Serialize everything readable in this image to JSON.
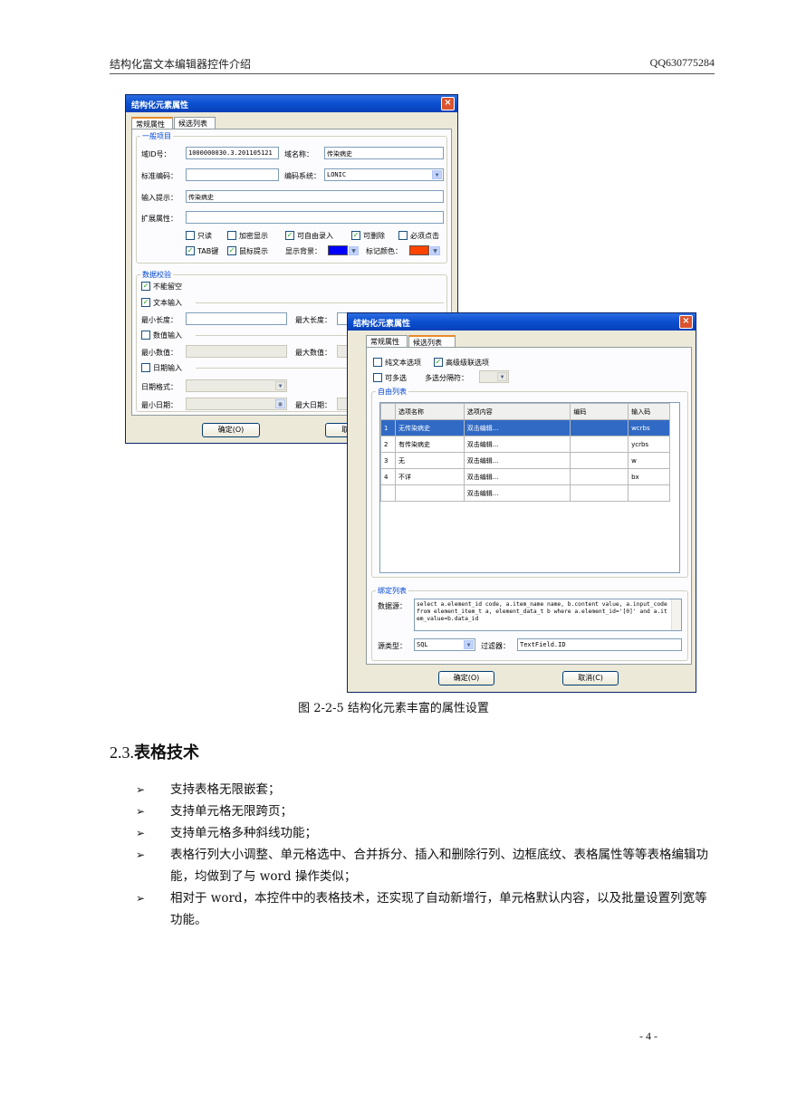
{
  "header": {
    "left": "结构化富文本编辑器控件介绍",
    "right": "QQ630775284"
  },
  "dialog1": {
    "title": "结构化元素属性",
    "tabs": [
      "常规属性",
      "候选列表"
    ],
    "group_general": "一般项目",
    "labels": {
      "field_id": "域ID号：",
      "field_name": "域名称：",
      "std_code": "标准编码：",
      "code_system": "编码系统：",
      "input_hint": "输入提示：",
      "ext_attr": "扩展属性：",
      "show_bg": "显示背景：",
      "mark_color": "标记颜色："
    },
    "values": {
      "field_id": "1000000030.3.201105121",
      "field_name": "传染病史",
      "code_system": "LONIC",
      "input_hint": "传染病史"
    },
    "checks_row1": [
      "只读",
      "加密显示",
      "可自由录入",
      "可删除",
      "必须点击"
    ],
    "checks_row2": [
      "TAB键",
      "鼠标提示"
    ],
    "group_validation": "数据校验",
    "not_empty": "不能留空",
    "text_input": "文本输入",
    "min_len": "最小长度：",
    "max_len": "最大长度：",
    "num_input": "数值输入",
    "min_num": "最小数值：",
    "max_num": "最大数值：",
    "date_input": "日期输入",
    "date_format": "日期格式：",
    "min_date": "最小日期：",
    "max_date": "最大日期：",
    "ok": "确定(O)",
    "cancel": "取消(C)",
    "colors": {
      "bg": "#0000ff",
      "mark": "#ff4400"
    }
  },
  "dialog2": {
    "title": "结构化元素属性",
    "tabs": [
      "常规属性",
      "候选列表"
    ],
    "pure_text": "纯文本选项",
    "advanced": "高级级联选项",
    "multi": "可多选",
    "separator": "多选分隔符：",
    "group_free": "自由列表",
    "columns": [
      "选项名称",
      "选项内容",
      "编码",
      "输入码"
    ],
    "rows": [
      {
        "no": "1",
        "name": "无传染病史",
        "content": "双击编辑...",
        "code": "",
        "input": "wcrbs"
      },
      {
        "no": "2",
        "name": "有传染病史",
        "content": "双击编辑...",
        "code": "",
        "input": "ycrbs"
      },
      {
        "no": "3",
        "name": "无",
        "content": "双击编辑...",
        "code": "",
        "input": "w"
      },
      {
        "no": "4",
        "name": "不详",
        "content": "双击编辑...",
        "code": "",
        "input": "bx"
      },
      {
        "no": "",
        "name": "",
        "content": "双击编辑...",
        "code": "",
        "input": ""
      }
    ],
    "group_bind": "绑定列表",
    "datasource": "数据源：",
    "sql": "select a.element_id code, a.item_name name, b.content value, a.input_code from element_item_t a, element_data_t b where a.element_id='[0]' and a.item_value=b.data_id",
    "source_type": "源类型：",
    "source_type_value": "SQL",
    "filter": "过滤器：",
    "filter_value": "TextField.ID",
    "ok": "确定(O)",
    "cancel": "取消(C)"
  },
  "caption": "图 2-2-5 结构化元素丰富的属性设置",
  "section": {
    "number": "2.3.",
    "title": "表格技术"
  },
  "bullets": [
    "支持表格无限嵌套；",
    "支持单元格无限跨页；",
    "支持单元格多种斜线功能；",
    "表格行列大小调整、单元格选中、合并拆分、插入和删除行列、边框底纹、表格属性等等表格编辑功能，均做到了与 word 操作类似；",
    "相对于 word，本控件中的表格技术，还实现了自动新增行，单元格默认内容，以及批量设置列宽等功能。"
  ],
  "page_number": "- 4 -"
}
